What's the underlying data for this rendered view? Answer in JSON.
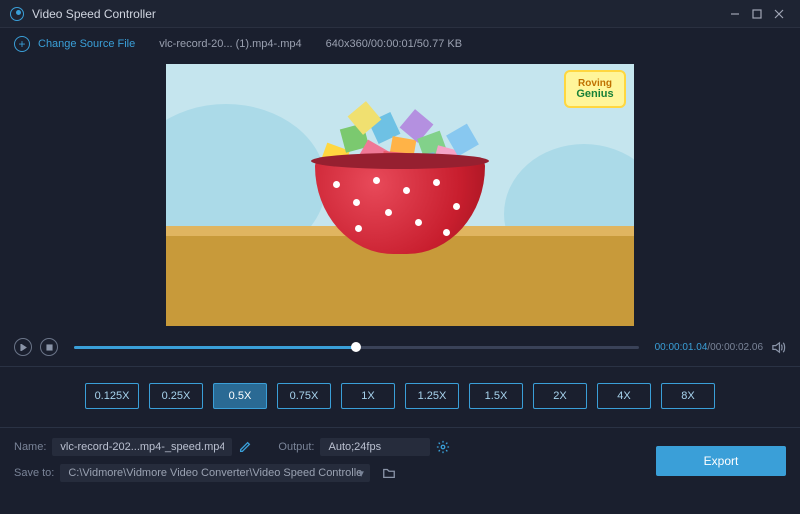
{
  "title": "Video Speed Controller",
  "toolbar": {
    "change_source": "Change Source File",
    "file_name": "vlc-record-20... (1).mp4-.mp4",
    "file_meta": "640x360/00:00:01/50.77 KB"
  },
  "logo": {
    "line1": "Roving",
    "line2": "Genius"
  },
  "playback": {
    "current": "00:00:01.04",
    "total": "00:00:02.06",
    "progress_pct": 50
  },
  "speeds": [
    "0.125X",
    "0.25X",
    "0.5X",
    "0.75X",
    "1X",
    "1.25X",
    "1.5X",
    "2X",
    "4X",
    "8X"
  ],
  "speed_active": "0.5X",
  "bottom": {
    "name_label": "Name:",
    "name_value": "vlc-record-202...mp4-_speed.mp4",
    "output_label": "Output:",
    "output_value": "Auto;24fps",
    "save_label": "Save to:",
    "save_path": "C:\\Vidmore\\Vidmore Video Converter\\Video Speed Controller",
    "export": "Export"
  }
}
